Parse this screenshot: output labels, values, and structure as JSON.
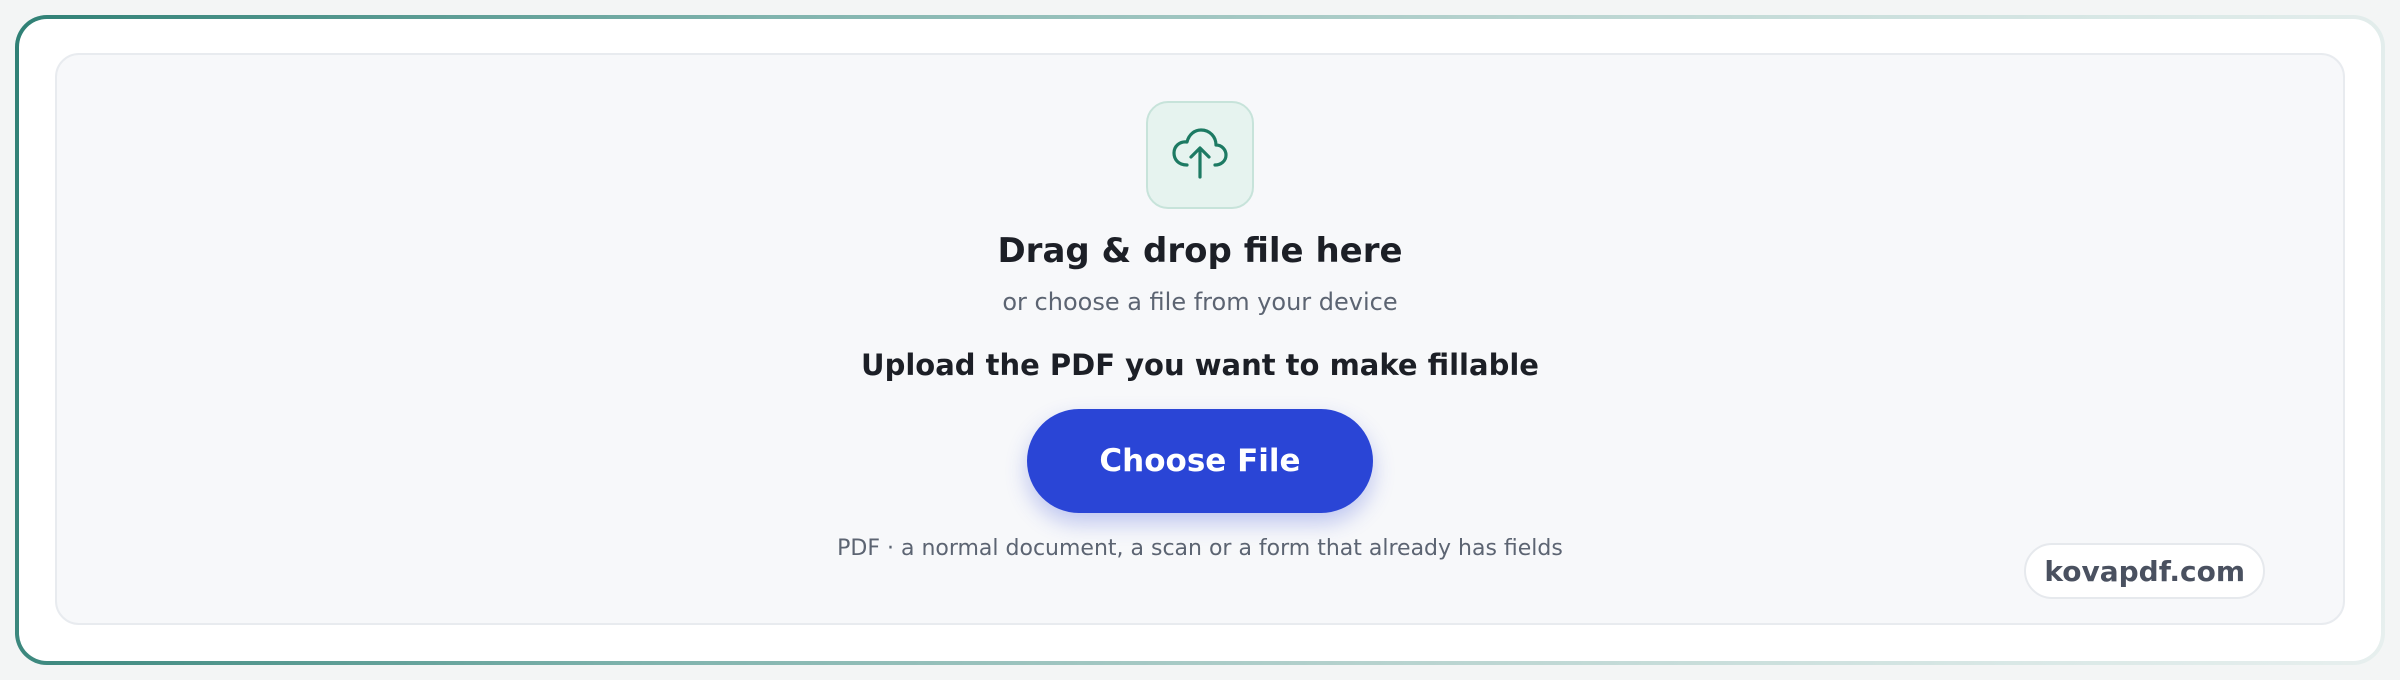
{
  "upload": {
    "icon": "cloud-upload-icon",
    "title": "Drag & drop file here",
    "subtitle": "or choose a file from your device",
    "instruction": "Upload the PDF you want to make fillable",
    "button_label": "Choose File",
    "hint": "PDF · a normal document, a scan or a form that already has fields"
  },
  "brand": {
    "label": "kovapdf.com"
  },
  "colors": {
    "accent": "#2a45d6",
    "icon_stroke": "#1d7a63",
    "icon_tile_bg": "#e6f3ef",
    "frame_gradient_start": "#2f8075",
    "dropzone_bg": "#f7f8fa"
  }
}
